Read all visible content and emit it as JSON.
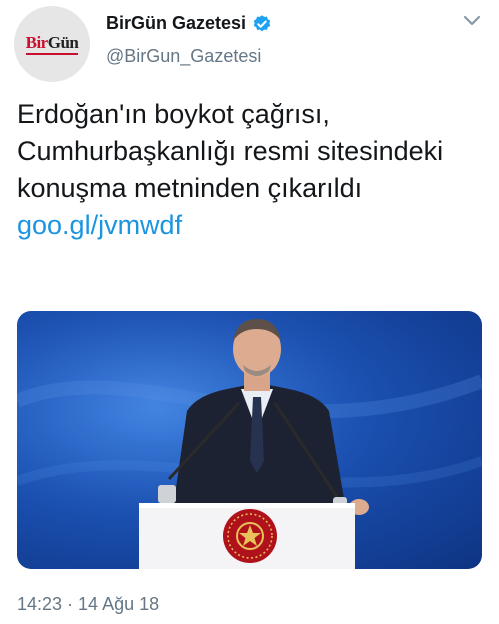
{
  "account": {
    "display_name": "BirGün Gazetesi",
    "handle": "@BirGun_Gazetesi",
    "avatar_logo_text": "BirGün",
    "verified": true
  },
  "tweet": {
    "text": "Erdoğan'ın boykot çağrısı, Cumhurbaşkanlığı resmi sitesindeki konuşma metninden çıkarıldı",
    "link": "goo.gl/jvmwdf",
    "timestamp": "14:23 · 14 Ağu 18"
  },
  "colors": {
    "text": "#14171a",
    "secondary": "#657786",
    "link": "#1b95e0",
    "verified_badge": "#1da1f2",
    "logo_red": "#c8102e"
  },
  "icons": {
    "verified": "verified-badge-icon",
    "menu": "chevron-down-icon"
  }
}
